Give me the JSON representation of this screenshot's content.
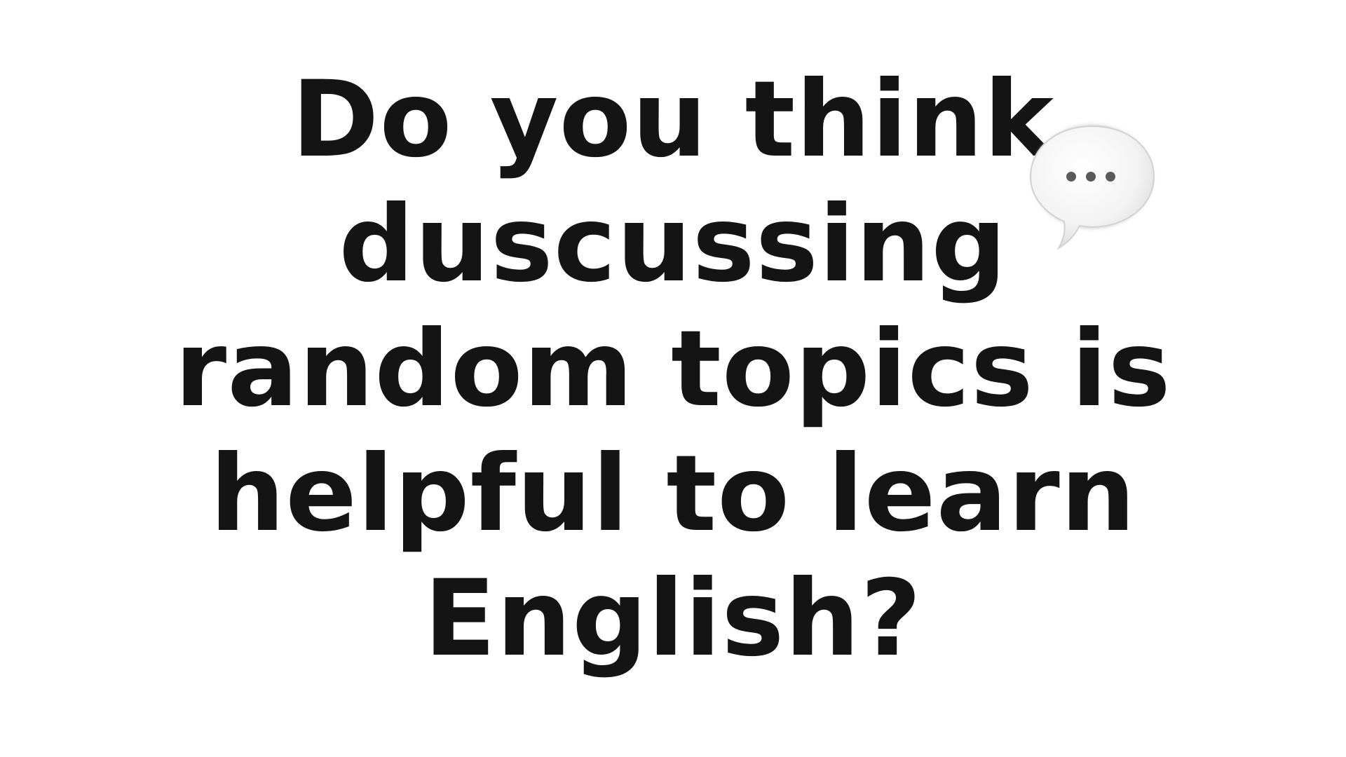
{
  "question": {
    "lines": [
      "Do you think",
      "duscussing",
      "random topics is",
      "helpful to learn",
      "English?"
    ]
  },
  "icons": {
    "speech_bubble": "speech-bubble-ellipsis-icon"
  },
  "colors": {
    "background": "#ffffff",
    "text": "#141414",
    "bubble_fill": "#f4f4f4",
    "bubble_dots": "#5a5a5a"
  }
}
